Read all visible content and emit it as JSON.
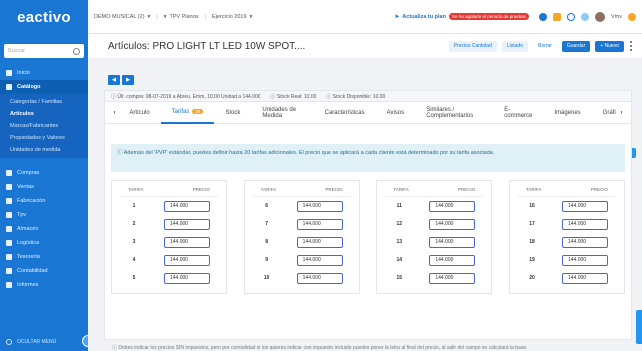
{
  "sidebar": {
    "logo": "eactivo",
    "search_placeholder": "Buscar",
    "items_top": [
      {
        "label": "Inicio",
        "icon": "home-icon"
      },
      {
        "label": "Catálogo",
        "icon": "book-icon",
        "active": true
      }
    ],
    "submenu": [
      {
        "label": "Categorías / Familias"
      },
      {
        "label": "Artículos",
        "active": true
      },
      {
        "label": "Marcas/Fabricantes"
      },
      {
        "label": "Propiedades y Valores"
      },
      {
        "label": "Unidades de medida"
      }
    ],
    "items_bottom": [
      {
        "label": "Compras",
        "icon": "cart-icon"
      },
      {
        "label": "Ventas",
        "icon": "sales-icon"
      },
      {
        "label": "Fabricación",
        "icon": "factory-icon"
      },
      {
        "label": "Tpv",
        "icon": "pos-icon"
      },
      {
        "label": "Almacén",
        "icon": "warehouse-icon"
      },
      {
        "label": "Logística",
        "icon": "truck-icon"
      },
      {
        "label": "Tesorería",
        "icon": "euro-icon"
      },
      {
        "label": "Contabilidad",
        "icon": "euro-icon"
      },
      {
        "label": "Informes",
        "icon": "chart-icon"
      }
    ],
    "collapse_label": "OCULTAR MENÚ"
  },
  "topbar": {
    "company": "DEMO MUSICAL (2)",
    "pricelist": "TPV Pianos",
    "year": "Ejercicio 2019",
    "plan_label": "Actualiza tu plan",
    "plan_badge": "Se ha agotado el periodo de pruebas",
    "user": "Vmv"
  },
  "title": {
    "text": "Artículos: PRO LIGHT LT LED 10W SPOT....",
    "actions": [
      "Precios Cantidad",
      "Listado",
      "Borrar",
      "Guardar",
      "+ Nuevo"
    ]
  },
  "info": {
    "last_purchase": "Últ. compra: 08-07-2019 a Abreu, Emm, 10.00 Unidad a 144.00€",
    "stock_real": "Stock Real: 10.00",
    "stock_available": "Stock Disponible: 10.00"
  },
  "tabs": [
    {
      "label": "Artículo"
    },
    {
      "label": "Tarifas",
      "badge": "20",
      "active": true
    },
    {
      "label": "Stock"
    },
    {
      "label": "Unidades de Medida"
    },
    {
      "label": "Características"
    },
    {
      "label": "Avisos"
    },
    {
      "label": "Similares / Complementarios"
    },
    {
      "label": "E-commerce"
    },
    {
      "label": "Imágenes"
    },
    {
      "label": "Gráfi"
    }
  ],
  "note": "Además del 'PVP' estándar, puedes definir hasta 20 tarifas adicionales. El precio que se aplicará a cada cliente está determinado por su tarifa asociada.",
  "tier_header": {
    "tarifa": "TARIFA",
    "precio": "PRECIO"
  },
  "tiers": [
    [
      {
        "n": "1",
        "p": "144.000"
      },
      {
        "n": "2",
        "p": "144.000"
      },
      {
        "n": "3",
        "p": "144.000"
      },
      {
        "n": "4",
        "p": "144.000"
      },
      {
        "n": "5",
        "p": "144.000"
      }
    ],
    [
      {
        "n": "6",
        "p": "144.000"
      },
      {
        "n": "7",
        "p": "144.000"
      },
      {
        "n": "8",
        "p": "144.000"
      },
      {
        "n": "9",
        "p": "144.000"
      },
      {
        "n": "10",
        "p": "144.000"
      }
    ],
    [
      {
        "n": "11",
        "p": "144.000"
      },
      {
        "n": "12",
        "p": "144.000"
      },
      {
        "n": "13",
        "p": "144.000"
      },
      {
        "n": "14",
        "p": "144.000"
      },
      {
        "n": "15",
        "p": "144.000"
      }
    ],
    [
      {
        "n": "16",
        "p": "144.000"
      },
      {
        "n": "17",
        "p": "144.000"
      },
      {
        "n": "18",
        "p": "144.000"
      },
      {
        "n": "19",
        "p": "144.000"
      },
      {
        "n": "20",
        "p": "144.000"
      }
    ]
  ],
  "footer_note": "Debes indicar los precios SIN impuestos, pero por comodidad si los quieres indicar con impuesto incluido puedes poner la letra al final del precio, al salir del campo se calculará la base."
}
